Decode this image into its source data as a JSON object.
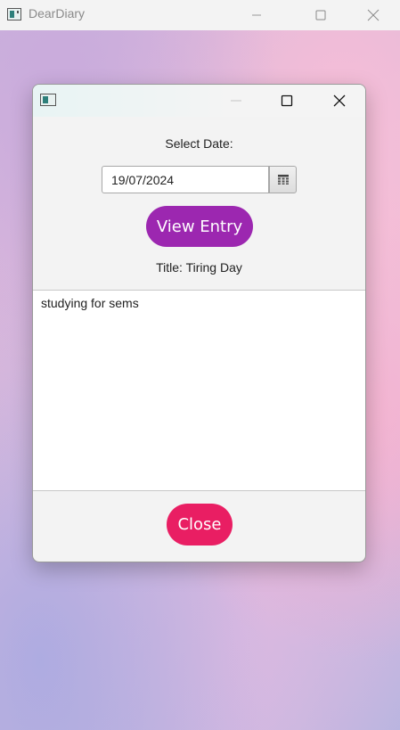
{
  "main_window": {
    "title": "DearDiary",
    "icon": "app-window-icon",
    "controls": [
      "minimize-icon",
      "maximize-icon",
      "close-icon"
    ]
  },
  "dialog": {
    "icon": "app-window-icon",
    "controls": [
      "minimize-icon",
      "maximize-icon",
      "close-icon"
    ],
    "select_date_label": "Select Date:",
    "date_value": "19/07/2024",
    "calendar_icon": "calendar-icon",
    "view_entry_label": "View Entry",
    "title_text": "Title: Tiring Day",
    "entry_text": "studying for sems",
    "close_label": "Close"
  },
  "colors": {
    "view_entry_button": "#9c27b0",
    "close_button": "#e91e63"
  }
}
